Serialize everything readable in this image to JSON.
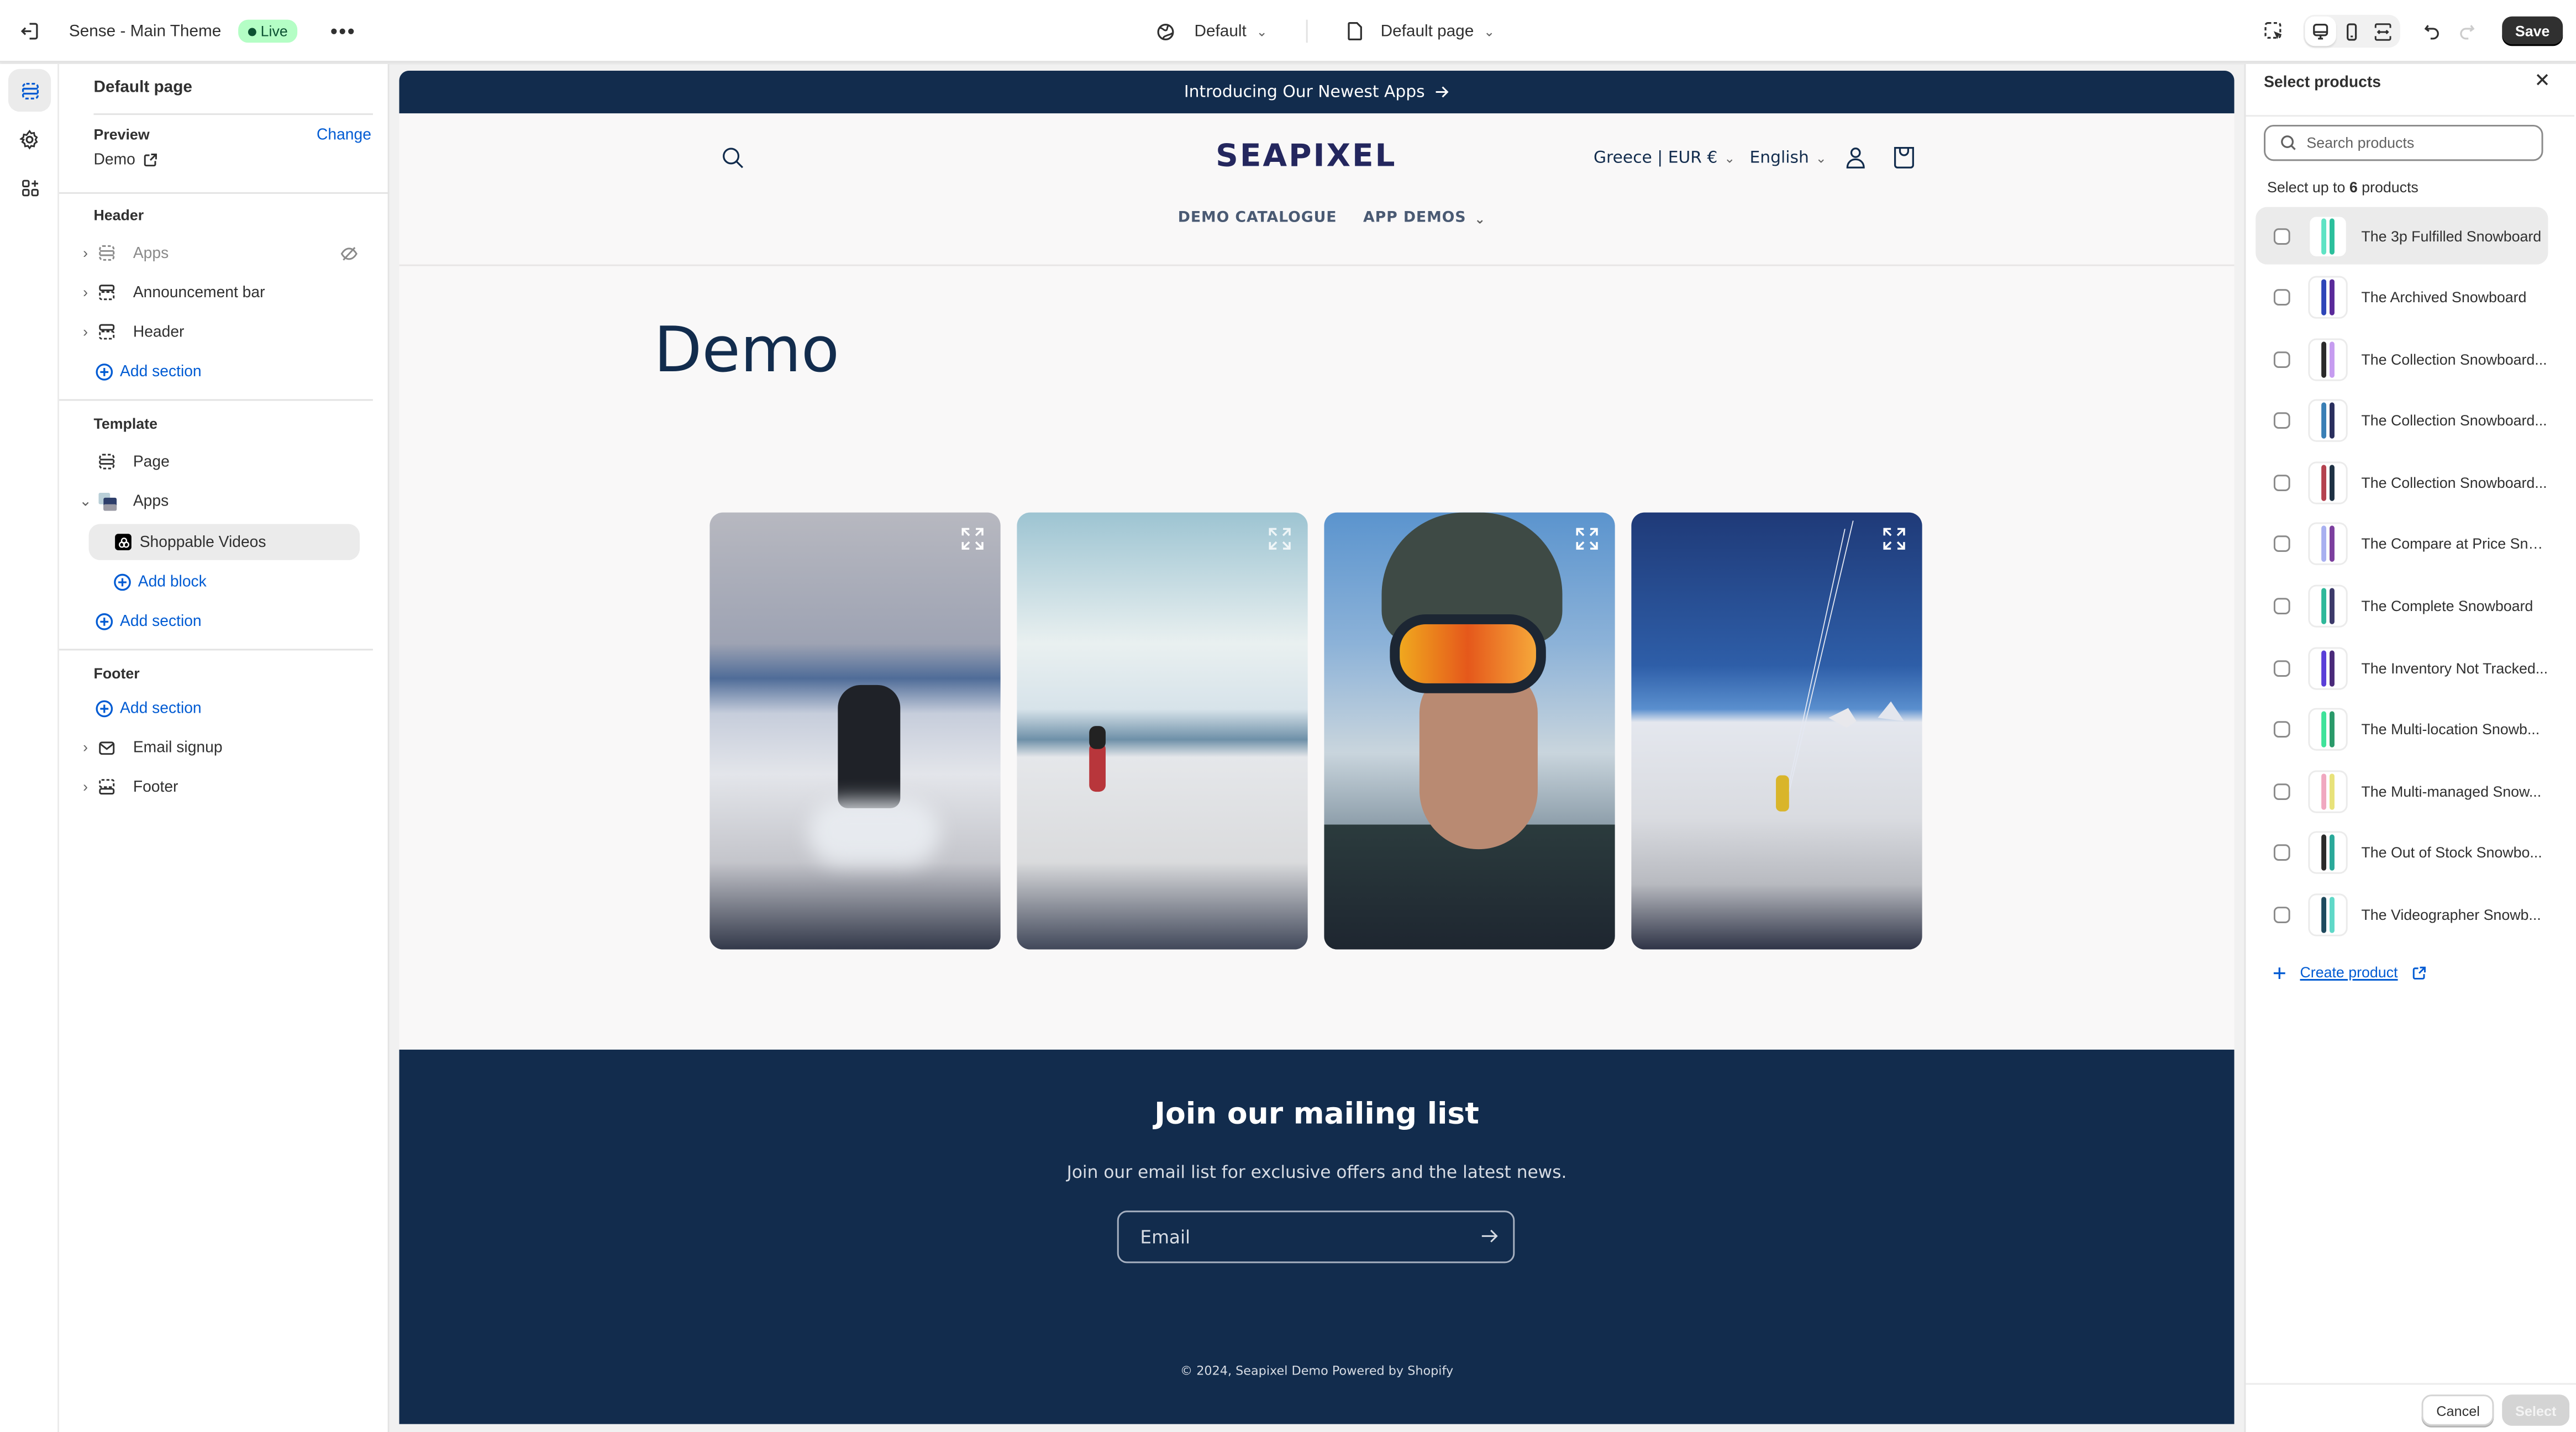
{
  "topbar": {
    "theme_name": "Sense - Main Theme",
    "status_badge": "Live",
    "more_label": "•••",
    "market_selector": "Default",
    "template_selector": "Default page",
    "save_label": "Save"
  },
  "sidebar": {
    "title": "Default page",
    "preview_label": "Preview",
    "change_label": "Change",
    "preview_value": "Demo",
    "groups": {
      "header": {
        "label": "Header",
        "items": [
          "Apps",
          "Announcement bar",
          "Header"
        ],
        "add_section": "Add section"
      },
      "template": {
        "label": "Template",
        "items": [
          "Page",
          "Apps"
        ],
        "block": "Shoppable Videos",
        "add_block": "Add block",
        "add_section": "Add section"
      },
      "footer": {
        "label": "Footer",
        "add_section": "Add section",
        "items": [
          "Email signup",
          "Footer"
        ]
      }
    }
  },
  "store": {
    "announcement": "Introducing Our Newest Apps",
    "logo": "SEAPIXEL",
    "country": "Greece | EUR €",
    "language": "English",
    "nav": [
      "DEMO CATALOGUE",
      "APP DEMOS"
    ],
    "page_title": "Demo",
    "videos": [
      "Snowboarder descending slope",
      "Snowboarder on piste",
      "Skier with orange goggles selfie",
      "Snowkiter jumping"
    ],
    "newsletter": {
      "title": "Join our mailing list",
      "subtitle": "Join our email list for exclusive offers and the latest news.",
      "email_placeholder": "Email"
    },
    "copyright": "© 2024, Seapixel Demo Powered by Shopify"
  },
  "product_picker": {
    "title": "Select products",
    "search_placeholder": "Search products",
    "hint_prefix": "Select up to ",
    "hint_count": "6",
    "hint_suffix": " products",
    "products": [
      {
        "name": "The 3p Fulfilled Snowboard",
        "colors": [
          "#5fe3c4",
          "#2bbf9c"
        ]
      },
      {
        "name": "The Archived Snowboard",
        "colors": [
          "#2f46b8",
          "#5a2a9a"
        ]
      },
      {
        "name": "The Collection Snowboard...",
        "colors": [
          "#2b2b2b",
          "#c69cf0"
        ]
      },
      {
        "name": "The Collection Snowboard...",
        "colors": [
          "#3a7fb5",
          "#2a2f5e"
        ]
      },
      {
        "name": "The Collection Snowboard...",
        "colors": [
          "#b4424f",
          "#1e3144"
        ]
      },
      {
        "name": "The Compare at Price Sno...",
        "colors": [
          "#a8b0f0",
          "#7c3f9e"
        ]
      },
      {
        "name": "The Complete Snowboard",
        "colors": [
          "#2fb89a",
          "#3d3a6a"
        ]
      },
      {
        "name": "The Inventory Not Tracked...",
        "colors": [
          "#5a3fd8",
          "#4a2a7a"
        ]
      },
      {
        "name": "The Multi-location Snowb...",
        "colors": [
          "#3fe39a",
          "#2a9a6a"
        ]
      },
      {
        "name": "The Multi-managed Snow...",
        "colors": [
          "#f0a8c0",
          "#e8e27a"
        ]
      },
      {
        "name": "The Out of Stock Snowbo...",
        "colors": [
          "#2b2b2b",
          "#2aa99a"
        ]
      },
      {
        "name": "The Videographer Snowb...",
        "colors": [
          "#1f4a5e",
          "#5fd8c8"
        ]
      }
    ],
    "create_product": "Create product",
    "cancel_label": "Cancel",
    "select_label": "Select"
  }
}
